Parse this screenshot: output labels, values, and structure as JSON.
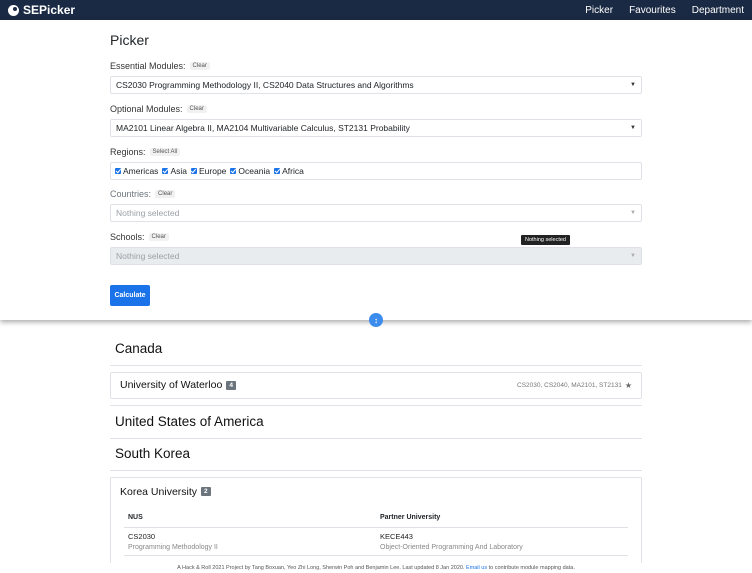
{
  "nav": {
    "brand": "SEPicker",
    "links": [
      "Picker",
      "Favourites",
      "Department"
    ]
  },
  "picker": {
    "title": "Picker",
    "essential": {
      "label": "Essential Modules:",
      "clear": "Clear",
      "value": "CS2030 Programming Methodology II, CS2040 Data Structures and Algorithms"
    },
    "optional": {
      "label": "Optional Modules:",
      "clear": "Clear",
      "value": "MA2101 Linear Algebra II, MA2104 Multivariable Calculus, ST2131 Probability"
    },
    "regions": {
      "label": "Regions:",
      "select_all": "Select All",
      "items": [
        "Americas",
        "Asia",
        "Europe",
        "Oceania",
        "Africa"
      ]
    },
    "countries": {
      "label": "Countries:",
      "clear": "Clear",
      "placeholder": "Nothing selected"
    },
    "schools": {
      "label": "Schools:",
      "clear": "Clear",
      "placeholder": "Nothing selected",
      "tooltip": "Nothing selected"
    },
    "calculate": "Calculate"
  },
  "results": {
    "countries": [
      {
        "name": "Canada",
        "universities": [
          {
            "name": "University of Waterloo",
            "count": "4",
            "modules": "CS2030, CS2040, MA2101, ST2131"
          }
        ]
      },
      {
        "name": "United States of America"
      },
      {
        "name": "South Korea",
        "universities": [
          {
            "name": "Korea University",
            "count": "2",
            "table": {
              "headers": [
                "NUS",
                "Partner University"
              ],
              "rows": [
                {
                  "nus_code": "CS2030",
                  "nus_name": "Programming Methodology II",
                  "partner_code": "KECE443",
                  "partner_name": "Object-Oriented Programming And Laboratory"
                }
              ]
            }
          }
        ]
      }
    ]
  },
  "footer": {
    "text": "A Hack & Roll 2021 Project by Tang Boxuan, Yeo Zhi Long, Sherwin Poh and Benjamin Lee. Last updated 8 Jan 2020.",
    "link": "Email us",
    "suffix": "to contribute module mapping data."
  }
}
